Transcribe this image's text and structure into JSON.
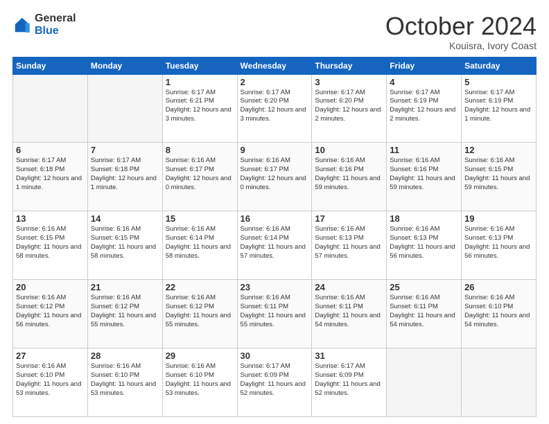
{
  "logo": {
    "general": "General",
    "blue": "Blue"
  },
  "header": {
    "month": "October 2024",
    "location": "Kouisra, Ivory Coast"
  },
  "weekdays": [
    "Sunday",
    "Monday",
    "Tuesday",
    "Wednesday",
    "Thursday",
    "Friday",
    "Saturday"
  ],
  "weeks": [
    [
      {
        "day": "",
        "info": ""
      },
      {
        "day": "",
        "info": ""
      },
      {
        "day": "1",
        "info": "Sunrise: 6:17 AM\nSunset: 6:21 PM\nDaylight: 12 hours and 3 minutes."
      },
      {
        "day": "2",
        "info": "Sunrise: 6:17 AM\nSunset: 6:20 PM\nDaylight: 12 hours and 3 minutes."
      },
      {
        "day": "3",
        "info": "Sunrise: 6:17 AM\nSunset: 6:20 PM\nDaylight: 12 hours and 2 minutes."
      },
      {
        "day": "4",
        "info": "Sunrise: 6:17 AM\nSunset: 6:19 PM\nDaylight: 12 hours and 2 minutes."
      },
      {
        "day": "5",
        "info": "Sunrise: 6:17 AM\nSunset: 6:19 PM\nDaylight: 12 hours and 1 minute."
      }
    ],
    [
      {
        "day": "6",
        "info": "Sunrise: 6:17 AM\nSunset: 6:18 PM\nDaylight: 12 hours and 1 minute."
      },
      {
        "day": "7",
        "info": "Sunrise: 6:17 AM\nSunset: 6:18 PM\nDaylight: 12 hours and 1 minute."
      },
      {
        "day": "8",
        "info": "Sunrise: 6:16 AM\nSunset: 6:17 PM\nDaylight: 12 hours and 0 minutes."
      },
      {
        "day": "9",
        "info": "Sunrise: 6:16 AM\nSunset: 6:17 PM\nDaylight: 12 hours and 0 minutes."
      },
      {
        "day": "10",
        "info": "Sunrise: 6:16 AM\nSunset: 6:16 PM\nDaylight: 11 hours and 59 minutes."
      },
      {
        "day": "11",
        "info": "Sunrise: 6:16 AM\nSunset: 6:16 PM\nDaylight: 11 hours and 59 minutes."
      },
      {
        "day": "12",
        "info": "Sunrise: 6:16 AM\nSunset: 6:15 PM\nDaylight: 11 hours and 59 minutes."
      }
    ],
    [
      {
        "day": "13",
        "info": "Sunrise: 6:16 AM\nSunset: 6:15 PM\nDaylight: 11 hours and 58 minutes."
      },
      {
        "day": "14",
        "info": "Sunrise: 6:16 AM\nSunset: 6:15 PM\nDaylight: 11 hours and 58 minutes."
      },
      {
        "day": "15",
        "info": "Sunrise: 6:16 AM\nSunset: 6:14 PM\nDaylight: 11 hours and 58 minutes."
      },
      {
        "day": "16",
        "info": "Sunrise: 6:16 AM\nSunset: 6:14 PM\nDaylight: 11 hours and 57 minutes."
      },
      {
        "day": "17",
        "info": "Sunrise: 6:16 AM\nSunset: 6:13 PM\nDaylight: 11 hours and 57 minutes."
      },
      {
        "day": "18",
        "info": "Sunrise: 6:16 AM\nSunset: 6:13 PM\nDaylight: 11 hours and 56 minutes."
      },
      {
        "day": "19",
        "info": "Sunrise: 6:16 AM\nSunset: 6:13 PM\nDaylight: 11 hours and 56 minutes."
      }
    ],
    [
      {
        "day": "20",
        "info": "Sunrise: 6:16 AM\nSunset: 6:12 PM\nDaylight: 11 hours and 56 minutes."
      },
      {
        "day": "21",
        "info": "Sunrise: 6:16 AM\nSunset: 6:12 PM\nDaylight: 11 hours and 55 minutes."
      },
      {
        "day": "22",
        "info": "Sunrise: 6:16 AM\nSunset: 6:12 PM\nDaylight: 11 hours and 55 minutes."
      },
      {
        "day": "23",
        "info": "Sunrise: 6:16 AM\nSunset: 6:11 PM\nDaylight: 11 hours and 55 minutes."
      },
      {
        "day": "24",
        "info": "Sunrise: 6:16 AM\nSunset: 6:11 PM\nDaylight: 11 hours and 54 minutes."
      },
      {
        "day": "25",
        "info": "Sunrise: 6:16 AM\nSunset: 6:11 PM\nDaylight: 11 hours and 54 minutes."
      },
      {
        "day": "26",
        "info": "Sunrise: 6:16 AM\nSunset: 6:10 PM\nDaylight: 11 hours and 54 minutes."
      }
    ],
    [
      {
        "day": "27",
        "info": "Sunrise: 6:16 AM\nSunset: 6:10 PM\nDaylight: 11 hours and 53 minutes."
      },
      {
        "day": "28",
        "info": "Sunrise: 6:16 AM\nSunset: 6:10 PM\nDaylight: 11 hours and 53 minutes."
      },
      {
        "day": "29",
        "info": "Sunrise: 6:16 AM\nSunset: 6:10 PM\nDaylight: 11 hours and 53 minutes."
      },
      {
        "day": "30",
        "info": "Sunrise: 6:17 AM\nSunset: 6:09 PM\nDaylight: 11 hours and 52 minutes."
      },
      {
        "day": "31",
        "info": "Sunrise: 6:17 AM\nSunset: 6:09 PM\nDaylight: 11 hours and 52 minutes."
      },
      {
        "day": "",
        "info": ""
      },
      {
        "day": "",
        "info": ""
      }
    ]
  ]
}
